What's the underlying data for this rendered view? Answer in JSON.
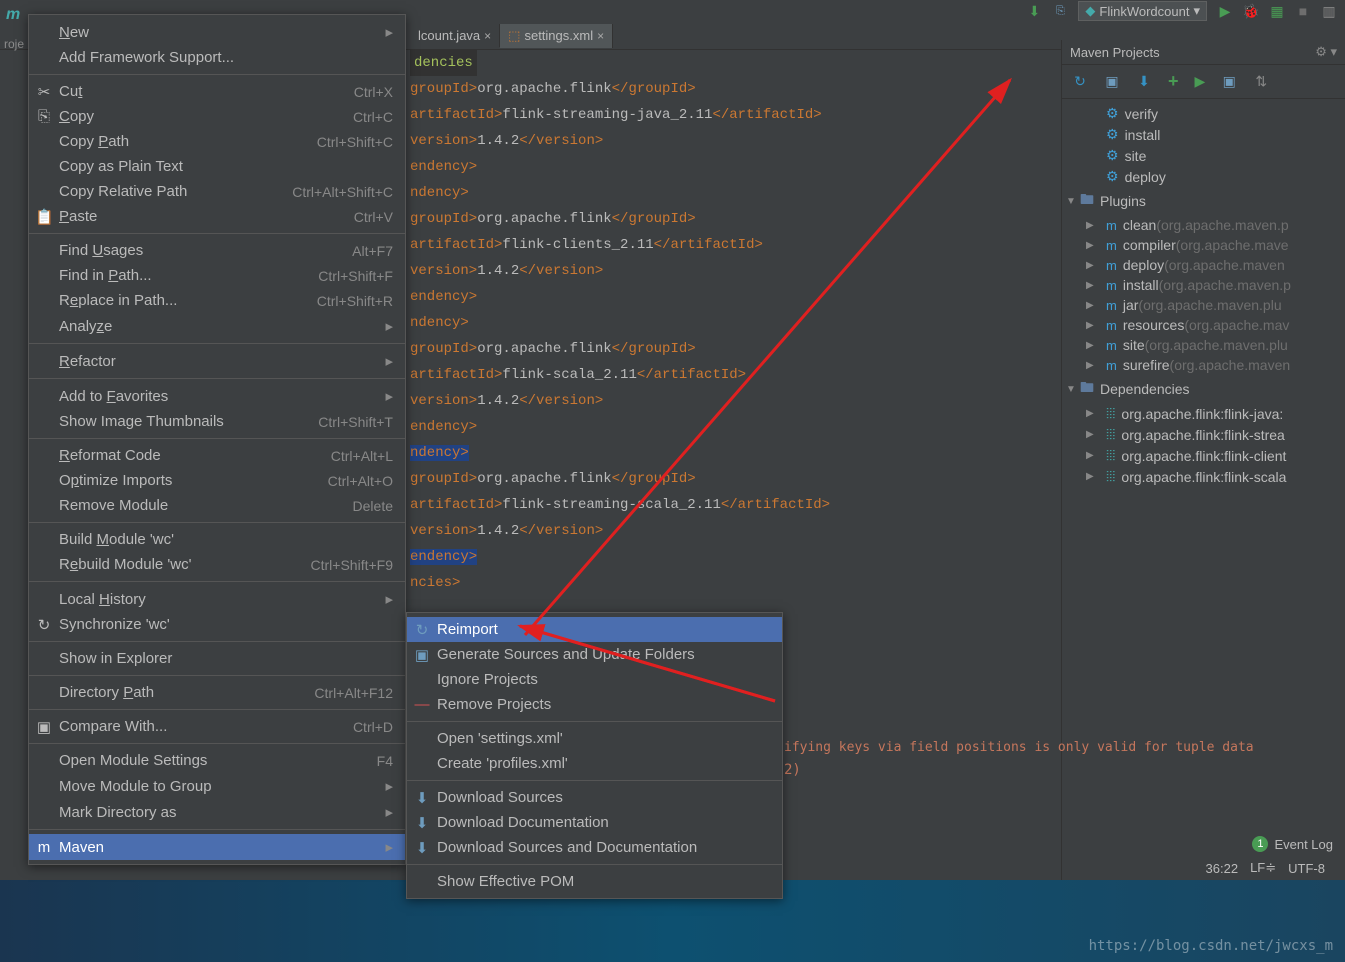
{
  "topbar": {
    "run_config": "FlinkWordcount"
  },
  "tabs": [
    {
      "label": "lcount.java",
      "active": false
    },
    {
      "label": "settings.xml",
      "active": true
    }
  ],
  "project_side": "roje",
  "context_menu": [
    [
      {
        "label": "New",
        "arrow": true,
        "u": 0
      },
      {
        "label": "Add Framework Support..."
      }
    ],
    [
      {
        "label": "Cut",
        "shortcut": "Ctrl+X",
        "icon": "✂",
        "u": 2
      },
      {
        "label": "Copy",
        "shortcut": "Ctrl+C",
        "icon": "⎘",
        "u": 0
      },
      {
        "label": "Copy Path",
        "shortcut": "Ctrl+Shift+C",
        "u": 5
      },
      {
        "label": "Copy as Plain Text"
      },
      {
        "label": "Copy Relative Path",
        "shortcut": "Ctrl+Alt+Shift+C"
      },
      {
        "label": "Paste",
        "shortcut": "Ctrl+V",
        "icon": "📋",
        "u": 0
      }
    ],
    [
      {
        "label": "Find Usages",
        "shortcut": "Alt+F7",
        "u": 5
      },
      {
        "label": "Find in Path...",
        "shortcut": "Ctrl+Shift+F",
        "u": 8
      },
      {
        "label": "Replace in Path...",
        "shortcut": "Ctrl+Shift+R",
        "u": 1
      },
      {
        "label": "Analyze",
        "arrow": true,
        "u": 5
      }
    ],
    [
      {
        "label": "Refactor",
        "arrow": true,
        "u": 0
      }
    ],
    [
      {
        "label": "Add to Favorites",
        "arrow": true,
        "u": 7
      },
      {
        "label": "Show Image Thumbnails",
        "shortcut": "Ctrl+Shift+T"
      }
    ],
    [
      {
        "label": "Reformat Code",
        "shortcut": "Ctrl+Alt+L",
        "u": 0
      },
      {
        "label": "Optimize Imports",
        "shortcut": "Ctrl+Alt+O",
        "u": 1
      },
      {
        "label": "Remove Module",
        "shortcut": "Delete"
      }
    ],
    [
      {
        "label": "Build Module 'wc'",
        "u": 6
      },
      {
        "label": "Rebuild Module 'wc'",
        "shortcut": "Ctrl+Shift+F9",
        "u": 1
      }
    ],
    [
      {
        "label": "Local History",
        "arrow": true,
        "u": 6
      },
      {
        "label": "Synchronize 'wc'",
        "icon": "↻"
      }
    ],
    [
      {
        "label": "Show in Explorer"
      }
    ],
    [
      {
        "label": "Directory Path",
        "shortcut": "Ctrl+Alt+F12",
        "u": 10
      }
    ],
    [
      {
        "label": "Compare With...",
        "shortcut": "Ctrl+D",
        "icon": "▣"
      }
    ],
    [
      {
        "label": "Open Module Settings",
        "shortcut": "F4"
      },
      {
        "label": "Move Module to Group",
        "arrow": true
      },
      {
        "label": "Mark Directory as",
        "arrow": true
      }
    ],
    [
      {
        "label": "Maven",
        "arrow": true,
        "highlighted": true,
        "icon": "m"
      }
    ]
  ],
  "submenu": [
    [
      {
        "label": "Reimport",
        "highlighted": true,
        "icon": "↻"
      },
      {
        "label": "Generate Sources and Update Folders",
        "icon": "▣"
      },
      {
        "label": "Ignore Projects"
      },
      {
        "label": "Remove Projects",
        "icon": "—"
      }
    ],
    [
      {
        "label": "Open 'settings.xml'"
      },
      {
        "label": "Create 'profiles.xml'"
      }
    ],
    [
      {
        "label": "Download Sources",
        "icon": "⬇"
      },
      {
        "label": "Download Documentation",
        "icon": "⬇"
      },
      {
        "label": "Download Sources and Documentation",
        "icon": "⬇"
      }
    ],
    [
      {
        "label": "Show Effective POM"
      }
    ]
  ],
  "maven": {
    "title": "Maven Projects",
    "lifecycle": [
      "verify",
      "install",
      "site",
      "deploy"
    ],
    "plugins_header": "Plugins",
    "plugins": [
      {
        "name": "clean",
        "hint": "(org.apache.maven.p"
      },
      {
        "name": "compiler",
        "hint": "(org.apache.mave"
      },
      {
        "name": "deploy",
        "hint": "(org.apache.maven"
      },
      {
        "name": "install",
        "hint": "(org.apache.maven.p"
      },
      {
        "name": "jar",
        "hint": "(org.apache.maven.plu"
      },
      {
        "name": "resources",
        "hint": "(org.apache.mav"
      },
      {
        "name": "site",
        "hint": "(org.apache.maven.plu"
      },
      {
        "name": "surefire",
        "hint": "(org.apache.maven"
      }
    ],
    "dependencies_header": "Dependencies",
    "dependencies": [
      "org.apache.flink:flink-java:",
      "org.apache.flink:flink-strea",
      "org.apache.flink:flink-client",
      "org.apache.flink:flink-scala"
    ]
  },
  "editor_deps_label": "dencies",
  "warning": "ifying keys via field positions is only valid for tuple data",
  "warning2": "2)",
  "event_log": {
    "count": "1",
    "label": "Event Log"
  },
  "status": {
    "pos": "36:22",
    "sep": "LF",
    "enc": "UTF-8"
  },
  "watermark": "https://blog.csdn.net/jwcxs_m"
}
